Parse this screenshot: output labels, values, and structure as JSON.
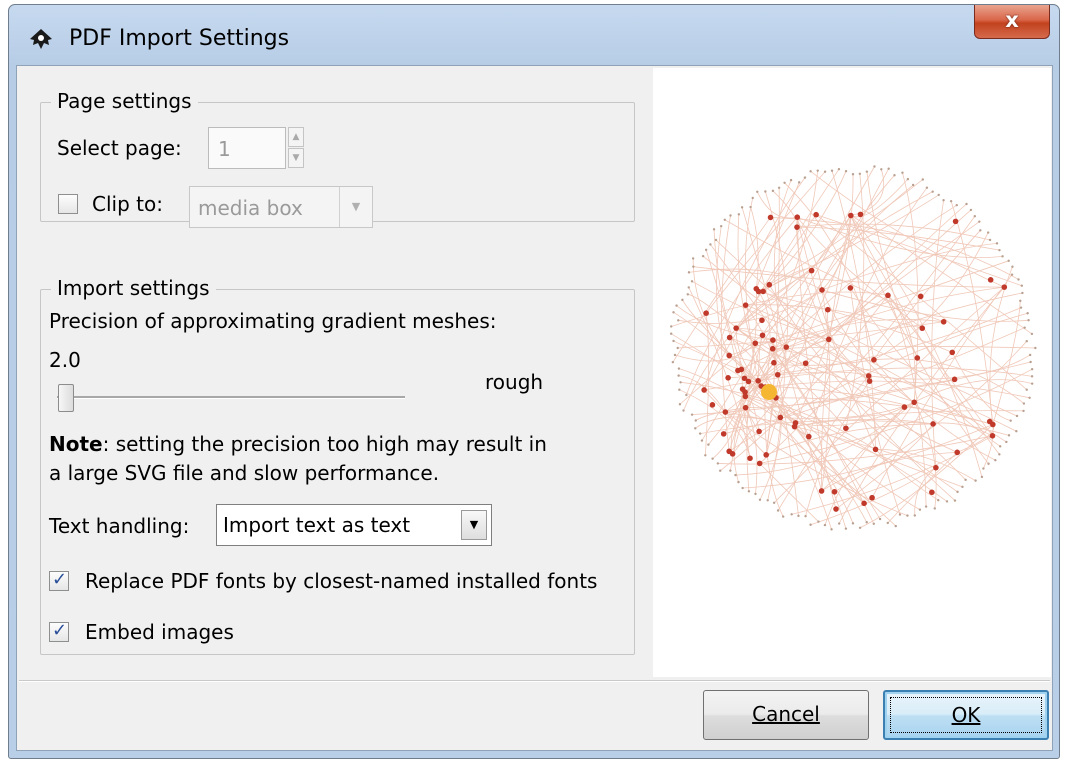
{
  "window": {
    "title": "PDF Import Settings",
    "close_label": "x"
  },
  "page_settings": {
    "legend": "Page settings",
    "select_page_label": "Select page:",
    "select_page_value": "1",
    "clip_to_label": "Clip to:",
    "clip_to_checked": false,
    "clip_to_value": "media box"
  },
  "import_settings": {
    "legend": "Import settings",
    "precision_label": "Precision of approximating gradient meshes:",
    "precision_value": "2.0",
    "precision_level": 0,
    "precision_desc": "rough",
    "note_bold": "Note",
    "note_line1": ": setting the precision too high may result in",
    "note_line2": "a large SVG file and slow performance.",
    "text_handling_label": "Text handling:",
    "text_handling_value": "Import text as text",
    "replace_fonts_label": "Replace PDF fonts by closest-named installed fonts",
    "replace_fonts_checked": true,
    "embed_images_label": "Embed images",
    "embed_images_checked": true
  },
  "buttons": {
    "cancel": "Cancel",
    "ok": "OK"
  },
  "colors": {
    "node": "#c0392b",
    "edge": "#f0c8b8",
    "highlight_node": "#f5b731"
  }
}
